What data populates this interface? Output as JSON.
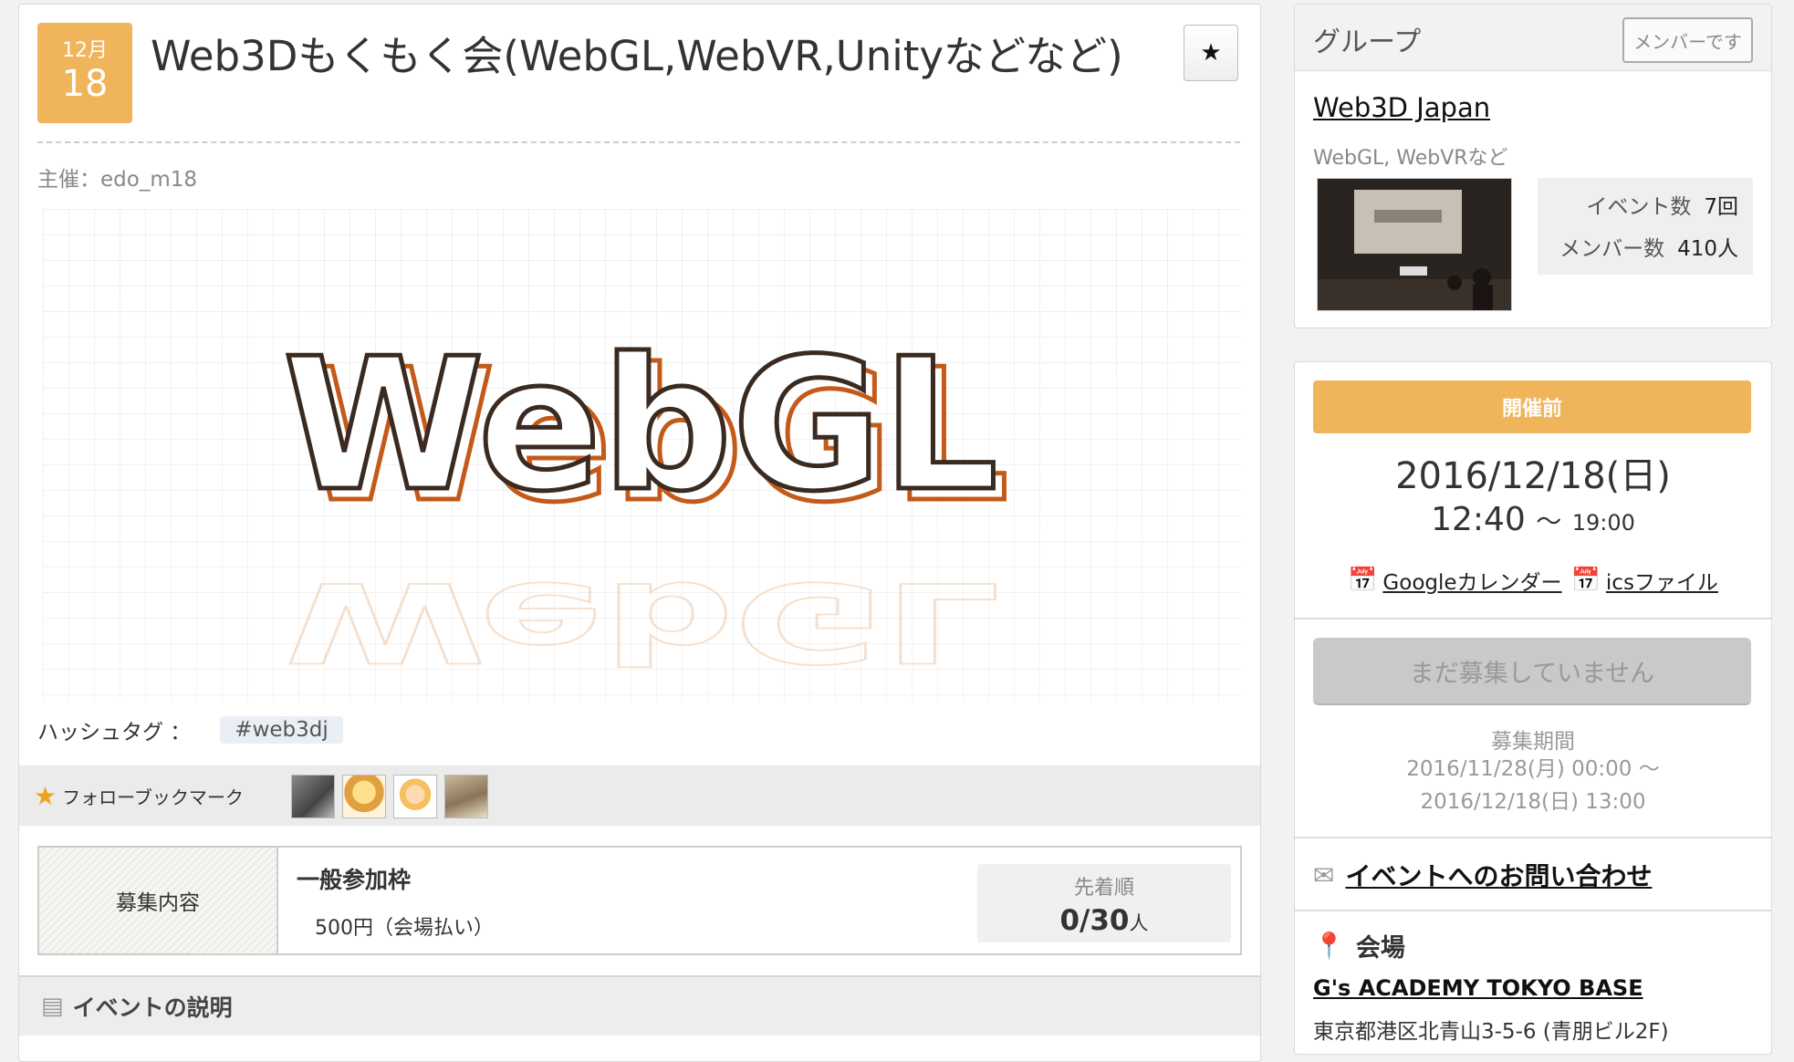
{
  "event": {
    "month": "12月",
    "day": "18",
    "title": "Web3Dもくもく会(WebGL,WebVR,Unityなどなど)",
    "bookmark_icon": "star-icon",
    "owner": "主催：edo_m18",
    "hero_text": "WebGL",
    "hashtag_label": "ハッシュタグ ：",
    "hashtag": "#web3dj",
    "follow_label": "フォローブックマーク",
    "recruit": {
      "header": "募集内容",
      "name": "一般参加枠",
      "fee": "500円（会場払い）",
      "order_label": "先着順",
      "count": "0/30",
      "unit": "人"
    },
    "description_heading": "イベントの説明"
  },
  "group": {
    "heading": "グループ",
    "member_button": "メンバーです",
    "name": "Web3D Japan",
    "description": "WebGL, WebVRなど",
    "events_label": "イベント数",
    "events_value": "7回",
    "members_label": "メンバー数",
    "members_value": "410人"
  },
  "schedule": {
    "status": "開催前",
    "date": "2016/12/18(日)",
    "start": "12:40",
    "separator": "〜",
    "end": "19:00",
    "google_link": "Googleカレンダー",
    "ics_link": "icsファイル",
    "apply_button": "まだ募集していません",
    "period_label": "募集期間",
    "period_start": "2016/11/28(月) 00:00 〜",
    "period_end": "2016/12/18(日) 13:00",
    "contact": "イベントへのお問い合わせ",
    "venue_heading": "会場",
    "venue_name": "G's ACADEMY TOKYO BASE",
    "venue_address": "東京都港区北青山3-5-6 (青朋ビル2F)"
  }
}
